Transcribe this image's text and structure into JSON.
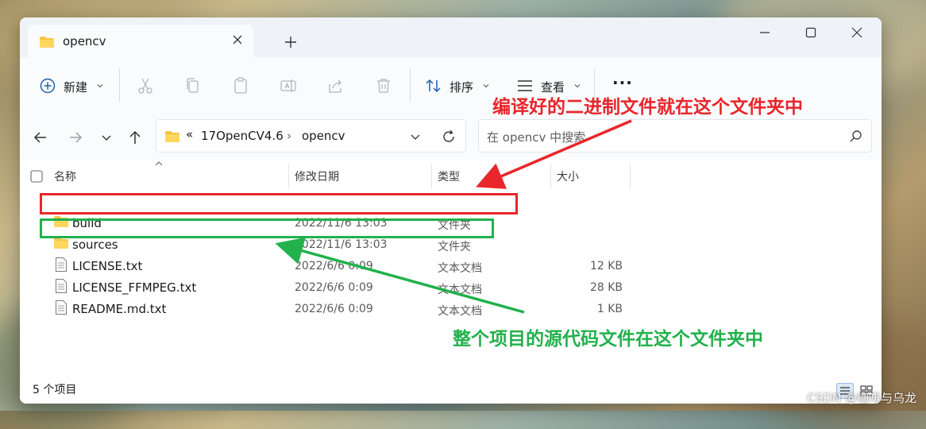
{
  "window": {
    "tab_title": "opencv",
    "new_tab_symbol": "+"
  },
  "toolbar": {
    "new_label": "新建",
    "sort_label": "排序",
    "view_label": "查看",
    "more_symbol": "···",
    "icons": [
      "plus-circle-icon",
      "cut-icon",
      "copy-icon",
      "paste-icon",
      "rename-icon",
      "share-icon",
      "delete-icon",
      "sort-icon",
      "view-icon",
      "more-icon"
    ]
  },
  "address": {
    "overflow": "«",
    "crumbs": [
      "17OpenCV4.6",
      "opencv"
    ],
    "separator": "›",
    "search_placeholder": "在 opencv 中搜索"
  },
  "columns": {
    "name": "名称",
    "date": "修改日期",
    "type": "类型",
    "size": "大小"
  },
  "files": [
    {
      "name": "build",
      "date": "2022/11/6 13:03",
      "type": "文件夹",
      "size": "",
      "icon": "folder-icon"
    },
    {
      "name": "sources",
      "date": "2022/11/6 13:03",
      "type": "文件夹",
      "size": "",
      "icon": "folder-icon"
    },
    {
      "name": "LICENSE.txt",
      "date": "2022/6/6 0:09",
      "type": "文本文档",
      "size": "12 KB",
      "icon": "text-file-icon"
    },
    {
      "name": "LICENSE_FFMPEG.txt",
      "date": "2022/6/6 0:09",
      "type": "文本文档",
      "size": "28 KB",
      "icon": "text-file-icon"
    },
    {
      "name": "README.md.txt",
      "date": "2022/6/6 0:09",
      "type": "文本文档",
      "size": "1 KB",
      "icon": "text-file-icon"
    }
  ],
  "status": {
    "item_count": "5 个项目"
  },
  "annotations": {
    "red_text": "编译好的二进制文件就在这个文件夹中",
    "green_text": "整个项目的源代码文件在这个文件夹中",
    "red_color": "#e8262b",
    "green_color": "#22b14c"
  },
  "watermark": "CSDN @咖啡与乌龙"
}
